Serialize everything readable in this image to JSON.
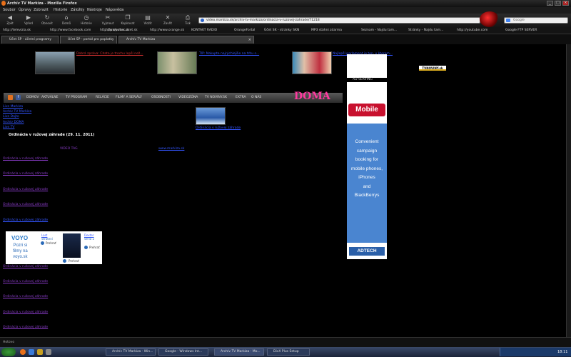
{
  "window": {
    "title": "Archív TV Markíza - Mozilla Firefox"
  },
  "menu": [
    "Soubor",
    "Úpravy",
    "Zobrazit",
    "Historie",
    "Záložky",
    "Nástroje",
    "Nápověda"
  ],
  "toolbar": {
    "buttons": [
      {
        "label": "Zpět",
        "icon": "back-arrow-icon"
      },
      {
        "label": "Vpřed",
        "icon": "forward-arrow-icon"
      },
      {
        "label": "Obnovit",
        "icon": "reload-icon"
      },
      {
        "label": "Domů",
        "icon": "home-icon"
      },
      {
        "label": "Historie",
        "icon": "history-icon"
      },
      {
        "label": "Vyjmout",
        "icon": "cut-icon"
      },
      {
        "label": "Kopírovat",
        "icon": "copy-icon"
      },
      {
        "label": "Vložit",
        "icon": "paste-icon"
      },
      {
        "label": "Zavřít",
        "icon": "close-icon"
      },
      {
        "label": "Tisk",
        "icon": "print-icon"
      }
    ],
    "url": "video.markiza.sk/archiv-tv-markiza/ordinacia-v-ruzovej-zahrade/71218",
    "search_placeholder": "Google"
  },
  "bookmarks": [
    "http://televizia.sk",
    "http://www.facebook.com",
    "http://www.rtvs.sk",
    "http://pokec.azet.sk",
    "http://www.orange.sk",
    "KONTAKT RADIO",
    "OrangeFortal",
    "Účet SK - stránky SKN",
    "MP3 stáhni zdarma",
    "Seznam - Najdu tam...",
    "Stránky - Najdu tam...",
    "http://youtube.com",
    "Google FTP SERVER"
  ],
  "tabs": [
    "Účet SP - účetní programy",
    "Účet SP - portál pro poplatky",
    "Archív TV Markíza"
  ],
  "page": {
    "top_links": [
      "Dobrá zpráva: Chata je trochu lepší než...",
      "TIP: Nakupte najrýchlejšie na trhu s...",
      "Najlepší parlament je ten, v ktorom..."
    ],
    "ad_label": "AD SERVING",
    "tvnoviny_badge": "TVNOVINY.sk",
    "nav": [
      "DOMOV",
      "AKTUÁLNE",
      "TV PROGRAM",
      "RELÁCIE",
      "FILMY A SERIÁLY",
      "OSOBNOSTI",
      "VIDEOZÓNA",
      "TV NOVINY.SK",
      "EXTRA",
      "O NÁS"
    ],
    "doma_logo": "DOMA",
    "side_menu": [
      "Live Markíza",
      "Archív TV Markíza",
      "Live Dajto",
      "Archív DOMA",
      "Live TV"
    ],
    "heading": "Ordinácia v ružovej záhrade (29. 11. 2011)",
    "thumb_caption": "Ordinácia v ružovej záhrade",
    "col_video": "VIDEO TAG",
    "col_link": "www.markiza.sk",
    "episodes": [
      "Ordinácia v ružovej záhrade",
      "Ordinácia v ružovej záhrade",
      "Ordinácia v ružovej záhrade",
      "Ordinácia v ružovej záhrade",
      "Ordinácia v ružovej záhrade",
      "Ordinácia v ružovej záhrade",
      "Ordinácia v ružovej záhrade",
      "Ordinácia v ružovej záhrade",
      "Ordinácia v ružovej záhrade",
      "Ordinácia v ružovej záhrade",
      "Ordinácia v ružovej záhrade",
      "Ordinácia v ružovej záhrade"
    ],
    "voyo": {
      "logo": "VOYO",
      "tagline_1": "Pozri si",
      "tagline_2": "filmy na",
      "tagline_3": "voyo.sk",
      "item1_title": "Lost",
      "item1_sub": "Stratení",
      "item1_play": "Prehrať",
      "item2_title": "Dexter",
      "item2_sub": "Séria 2",
      "item2_play": "Prehrať",
      "play_label": "Prehrať"
    },
    "sidebar_ad": {
      "mobile": "Mobile",
      "line1": "Convenient",
      "line2": "campaign",
      "line3": "booking for",
      "line4": "mobile phones,",
      "line5": "iPhones",
      "line6": "and",
      "line7": "BlackBerrys",
      "brand": "ADTECH"
    }
  },
  "statusbar": {
    "text": "Hotovo"
  },
  "taskbar": {
    "tasks": [
      "Archív TV Markíza - Win...",
      "Google - Windows Int...",
      "Archív TV Markíza - Mo...",
      "DivX Plus Setup"
    ],
    "clock": "18:11"
  }
}
